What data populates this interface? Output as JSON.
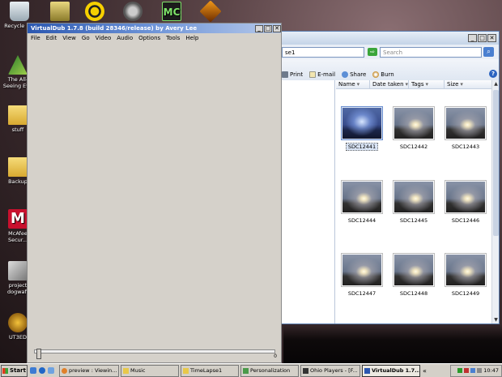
{
  "desktop": {
    "icons": [
      {
        "label": "Recycle Bin"
      },
      {
        "label": "The All-Seeing Eye"
      },
      {
        "label": "stuff"
      },
      {
        "label": "Backup"
      },
      {
        "label": "McAfee Secur..."
      },
      {
        "label": "project dogwaff"
      },
      {
        "label": "UT3ED"
      }
    ],
    "top_icons": [
      {
        "name": "folder-icon"
      },
      {
        "name": "radiation-icon"
      },
      {
        "name": "gear-icon"
      },
      {
        "name": "mc-icon",
        "text": "MC"
      },
      {
        "name": "game-icon"
      }
    ]
  },
  "virtualdub": {
    "title": "VirtualDub 1.7.8 (build 28346/release) by Avery Lee",
    "menu": [
      "File",
      "Edit",
      "View",
      "Go",
      "Video",
      "Audio",
      "Options",
      "Tools",
      "Help"
    ],
    "frame_end": "0"
  },
  "explorer": {
    "address": "se1",
    "search_placeholder": "Search",
    "toolbar": [
      "Print",
      "E-mail",
      "Share",
      "Burn"
    ],
    "columns": [
      "Name",
      "Date taken",
      "Tags",
      "Size"
    ],
    "files": [
      "SDC12441",
      "SDC12442",
      "SDC12443",
      "SDC12444",
      "SDC12445",
      "SDC12446",
      "SDC12447",
      "SDC12448",
      "SDC12449"
    ],
    "selected_file": "SDC12441"
  },
  "taskbar": {
    "start": "Start",
    "tasks": [
      {
        "label": "preview : Viewin..."
      },
      {
        "label": "Music"
      },
      {
        "label": "TimeLapse1"
      },
      {
        "label": "Personalization"
      },
      {
        "label": "Ohio Players - [F..."
      },
      {
        "label": "VirtualDub 1.7..."
      }
    ],
    "expand": "«",
    "clock": "10:47"
  }
}
